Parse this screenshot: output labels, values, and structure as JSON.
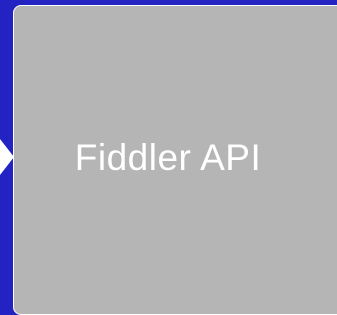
{
  "diagram": {
    "node": {
      "label": "Fiddler API"
    },
    "colors": {
      "background": "#2323c4",
      "node_fill": "#b5b5b5",
      "node_border": "#ffffff",
      "label": "#ffffff",
      "arrow": "#ffffff"
    },
    "edges": [
      {
        "type": "arrow-into-node",
        "direction": "right"
      }
    ]
  }
}
